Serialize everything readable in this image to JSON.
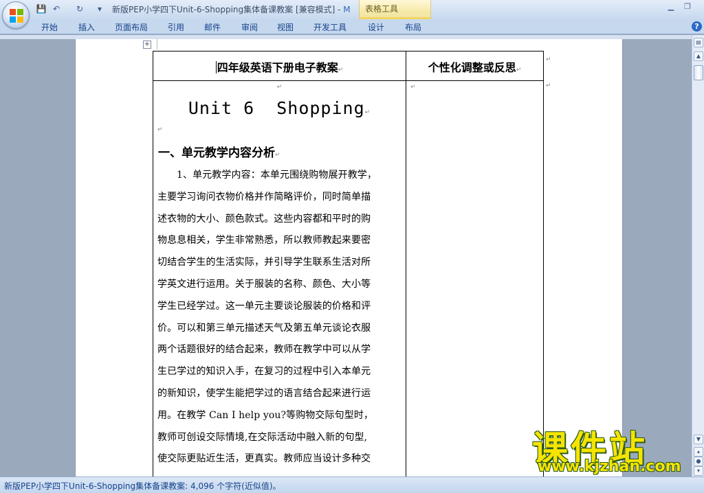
{
  "window": {
    "title": "新版PEP小学四下Unit-6-Shopping集体备课教案 [兼容模式] -",
    "title_app": "M",
    "context_tab": "表格工具",
    "minimize": "▁",
    "restore": "❐"
  },
  "quick_access": {
    "save": "💾",
    "undo": "↶",
    "redo": "↻",
    "more": "▾"
  },
  "tabs": [
    "开始",
    "插入",
    "页面布局",
    "引用",
    "邮件",
    "审阅",
    "视图",
    "开发工具",
    "设计",
    "布局"
  ],
  "help": "?",
  "table": {
    "header_left": "四年级英语下册电子教案",
    "header_right": "个性化调整或反思",
    "unit_title": "Unit 6  Shopping",
    "section_heading": "一、单元教学内容分析",
    "paragraph_mark": "↵",
    "lines": [
      "1、单元教学内容：本单元围绕购物展开教学，",
      "主要学习询问衣物价格并作简略评价，同时简单描",
      "述衣物的大小、颜色款式。这些内容都和平时的购",
      "物息息相关，学生非常熟悉，所以教师教起来要密",
      "切结合学生的生活实际，并引导学生联系生活对所",
      "学英文进行运用。关于服装的名称、颜色、大小等",
      "学生已经学过。这一单元主要谈论服装的价格和评",
      "价。可以和第三单元描述天气及第五单元谈论衣服",
      "两个话题很好的结合起来，教师在教学中可以从学",
      "生已学过的知识入手，在复习的过程中引入本单元",
      "的新知识，使学生能把学过的语言结合起来进行运",
      "用。在教学 Can I help you?等购物交际句型时，",
      "教师可创设交际情境,在交际活动中融入新的句型,",
      "使交际更贴近生活，更真实。教师应当设计多种交"
    ]
  },
  "statusbar": {
    "text": "新版PEP小学四下Unit-6-Shopping集体备课教案: 4,096 个字符(近似值)。"
  },
  "watermark": {
    "cn": "课件站",
    "url": "www.kjzhan.com"
  }
}
